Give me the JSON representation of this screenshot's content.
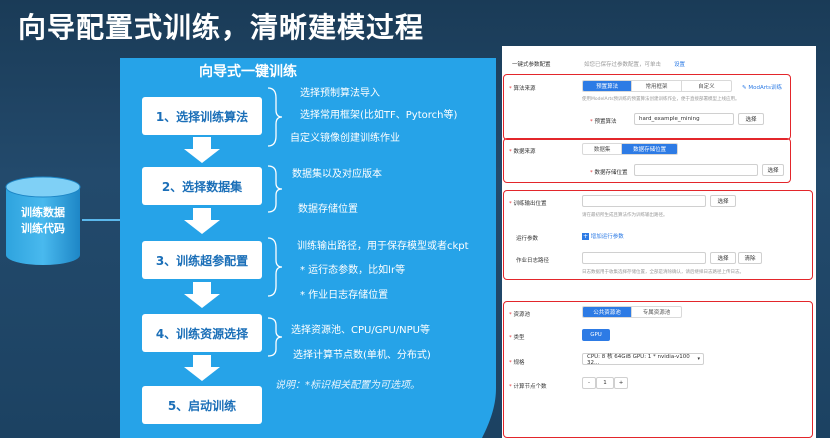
{
  "slide": {
    "title": "向导配置式训练，清晰建模过程"
  },
  "storage": {
    "line1": "训练数据",
    "line2": "训练代码"
  },
  "flow": {
    "title": "向导式一键训练",
    "steps": [
      {
        "label": "1、选择训练算法",
        "desc": [
          "选择预制算法导入",
          "选择常用框架(比如TF、Pytorch等)",
          "自定义镜像创建训练作业"
        ]
      },
      {
        "label": "2、选择数据集",
        "desc": [
          "数据集以及对应版本",
          "数据存储位置"
        ]
      },
      {
        "label": "3、训练超参配置",
        "desc": [
          "训练输出路径，用于保存模型或者ckpt",
          "* 运行态参数，比如lr等",
          "* 作业日志存储位置"
        ]
      },
      {
        "label": "4、训练资源选择",
        "desc": [
          "选择资源池、CPU/GPU/NPU等",
          "选择计算节点数(单机、分布式)"
        ]
      },
      {
        "label": "5、启动训练",
        "desc": []
      }
    ],
    "note": "说明：*标识相关配置为可选项。"
  },
  "form": {
    "top_label": "一键式参数配置",
    "top_hint": "如您已保存过参数配置，可单击",
    "top_link": "设置",
    "algo": {
      "label": "算法来源",
      "tabs": [
        "预置算法",
        "常用框架",
        "自定义"
      ],
      "active_tab": 0,
      "hint_link": "ModArts训练",
      "desc": "使用ModelArts预训练的预置算法创建训练作业，便于直接部署模型上线应用。",
      "field_label": "预置算法",
      "field_value": "hard_example_mining",
      "select_btn": "选择"
    },
    "data": {
      "label": "数据来源",
      "tabs": [
        "数据集",
        "数据存储位置"
      ],
      "active_tab": 1,
      "field_label": "数据存储位置",
      "select_btn": "选择"
    },
    "params": {
      "output_label": "训练输出位置",
      "output_btn": "选择",
      "output_hint": "请在最初所生成且算法作为训练输出路径。",
      "run_label": "运行参数",
      "run_add": "增加运行参数",
      "log_label": "作业日志路径",
      "log_btn": "选择",
      "log_clear": "清除",
      "log_hint": "日志数据用于收集选择存储位置，全部是清除确认，请后继择日志路径上传日志。"
    },
    "resource": {
      "pool_label": "资源池",
      "pool_tabs": [
        "公共资源池",
        "专属资源池"
      ],
      "active_pool": 0,
      "type_label": "类型",
      "type_value": "GPU",
      "spec_label": "规格",
      "spec_value": "CPU: 8 核 64GiB GPU: 1 * nvidia-v100 32...",
      "nodes_label": "计算节点个数",
      "nodes_minus": "-",
      "nodes_value": "1",
      "nodes_plus": "+"
    }
  }
}
